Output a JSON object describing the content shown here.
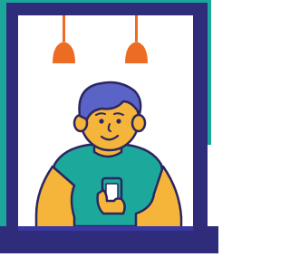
{
  "colors": {
    "teal": "#1aa79a",
    "navy": "#2f2c7c",
    "orange": "#ec6c24",
    "skin": "#f5b43a",
    "hair": "#5a63c6",
    "shirt": "#1ca99b",
    "stroke": "#2b2660",
    "white": "#ffffff",
    "floor": "#2f2c7c"
  },
  "icons": {
    "lamp_left": "pendant-lamp-icon",
    "lamp_right": "pendant-lamp-icon",
    "phone": "smartphone-icon"
  }
}
